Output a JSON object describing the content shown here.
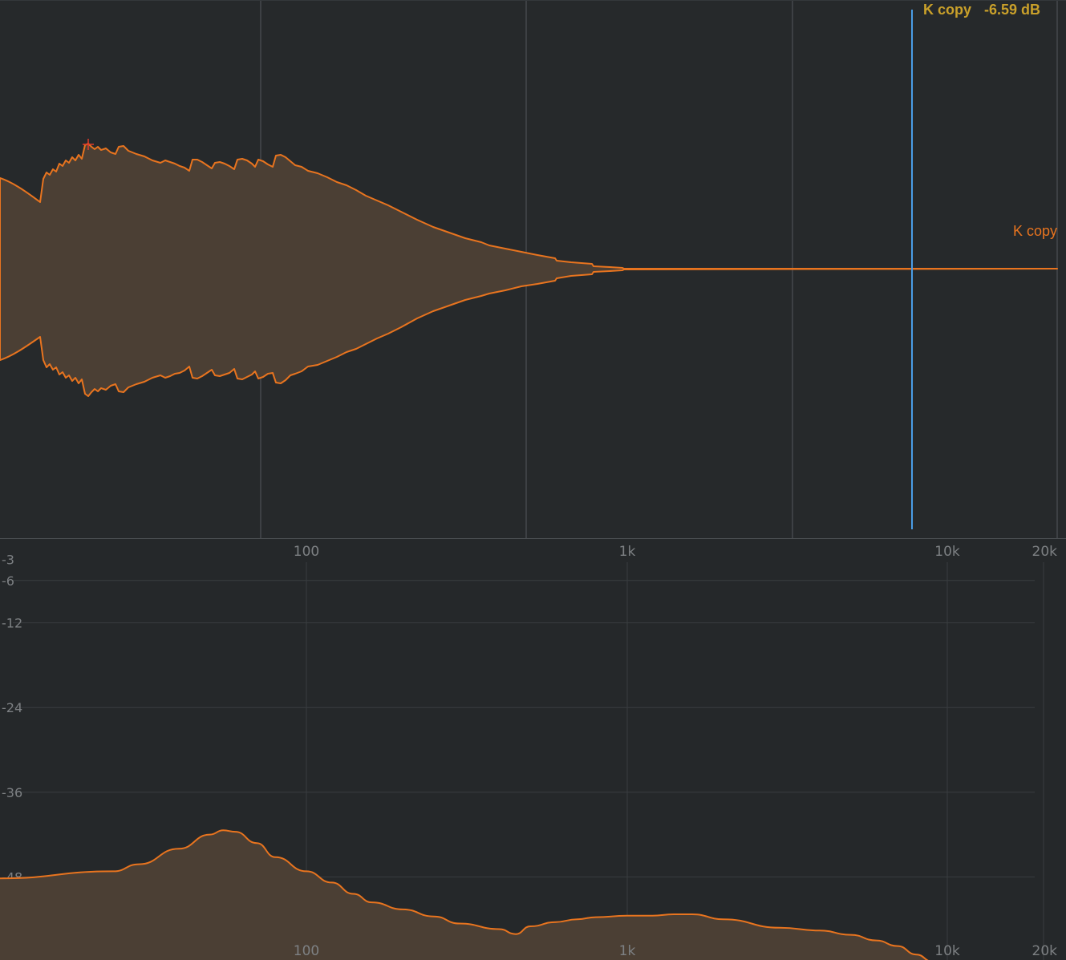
{
  "waveform": {
    "track_name": "K copy",
    "cursor_readout": {
      "label": "K copy",
      "value": "-6.59 dB"
    },
    "colors": {
      "background": "#26292b",
      "grid": "#45494c",
      "wave_stroke": "#e8741f",
      "wave_fill": "#4b3f34",
      "cursor": "#4a9de6",
      "readout": "#c9a02a",
      "peak_marker": "#e23b2a"
    }
  },
  "spectrum": {
    "colors": {
      "background": "#25282a",
      "grid": "#393d40",
      "curve_stroke": "#e8741f",
      "curve_fill": "#4b3f34"
    },
    "chart_data": {
      "type": "area",
      "xscale": "log",
      "xlim": [
        20,
        20000
      ],
      "ylim": [
        -60,
        0
      ],
      "x_tick_labels": [
        "100",
        "1k",
        "10k",
        "20k"
      ],
      "x_ticks": [
        100,
        1000,
        10000,
        20000
      ],
      "y_tick_labels": [
        "-3",
        "-6",
        "-12",
        "-24",
        "-36",
        "-48"
      ],
      "y_ticks": [
        -3,
        -6,
        -12,
        -24,
        -36,
        -48
      ],
      "series": [
        {
          "x": [
            20,
            25,
            30,
            40,
            50,
            55,
            60,
            70,
            80,
            100,
            120,
            140,
            160,
            200,
            250,
            300,
            400,
            450,
            500,
            600,
            700,
            800,
            1000,
            1200,
            1400,
            1600,
            2000,
            3000,
            4000,
            5000,
            6000,
            7000,
            8000,
            9000
          ],
          "y": [
            -48.2,
            -47.2,
            -46.2,
            -44.0,
            -42.0,
            -41.4,
            -41.6,
            -43.2,
            -45.2,
            -47.2,
            -48.8,
            -50.4,
            -51.6,
            -52.6,
            -53.6,
            -54.6,
            -55.4,
            -56.1,
            -55.0,
            -54.4,
            -54.0,
            -53.7,
            -53.5,
            -53.5,
            -53.3,
            -53.3,
            -54.0,
            -55.2,
            -55.6,
            -56.2,
            -57.0,
            -57.8,
            -59.0,
            -60.0
          ]
        }
      ]
    }
  }
}
